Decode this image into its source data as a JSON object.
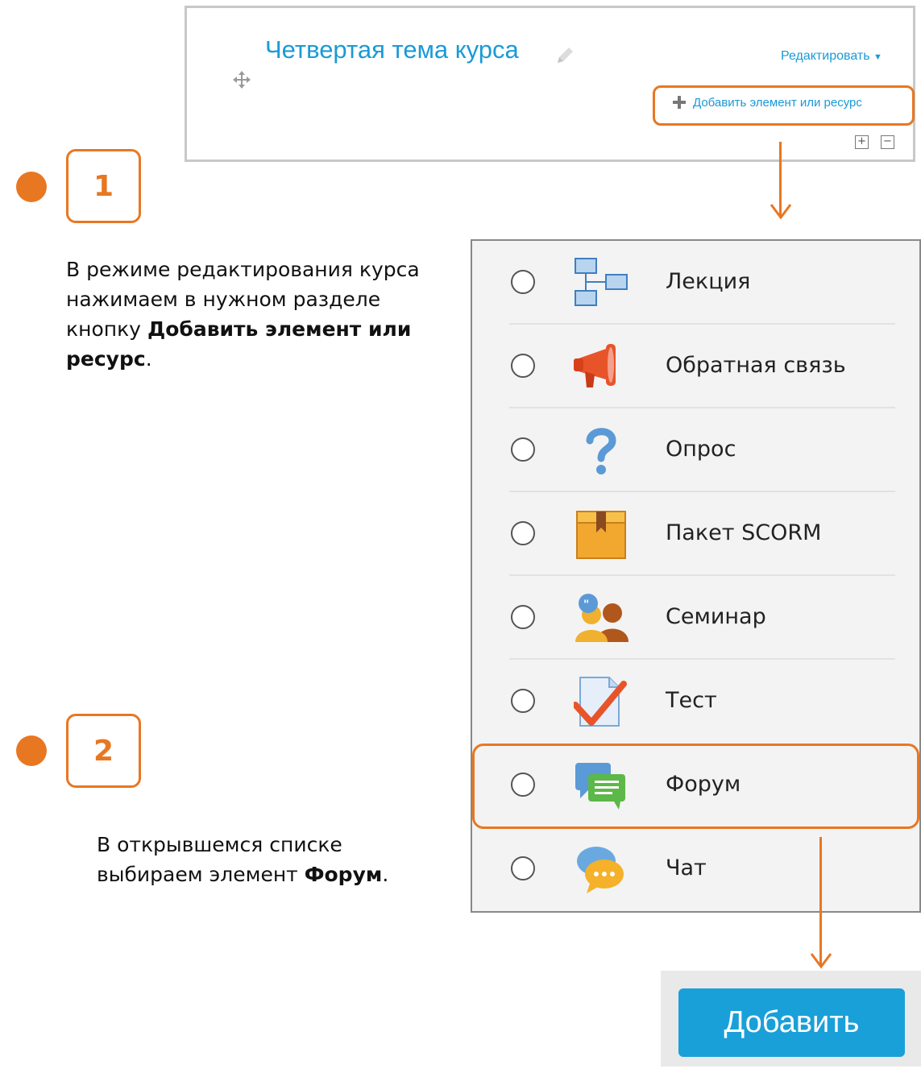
{
  "section": {
    "title": "Четвертая тема курса",
    "edit_label": "Редактировать",
    "add_link_label": "Добавить элемент или ресурс"
  },
  "steps": [
    {
      "number": "1",
      "text_plain": "В режиме редактирования курса нажимаем в нужном разделе кнопку ",
      "text_bold": "Добавить элемент или ресурс",
      "text_end": "."
    },
    {
      "number": "2",
      "text_plain": "В открывшемся списке выбираем элемент ",
      "text_bold": "Форум",
      "text_end": "."
    }
  ],
  "activities": [
    {
      "label": "Лекция",
      "icon": "lesson-icon"
    },
    {
      "label": "Обратная связь",
      "icon": "feedback-icon"
    },
    {
      "label": "Опрос",
      "icon": "choice-icon"
    },
    {
      "label": "Пакет SCORM",
      "icon": "scorm-icon"
    },
    {
      "label": "Семинар",
      "icon": "workshop-icon"
    },
    {
      "label": "Тест",
      "icon": "quiz-icon"
    },
    {
      "label": "Форум",
      "icon": "forum-icon"
    },
    {
      "label": "Чат",
      "icon": "chat-icon"
    }
  ],
  "selected_activity": "Форум",
  "add_button_label": "Добавить",
  "colors": {
    "accent": "#e87722",
    "link": "#1a9ad6",
    "button": "#1aa0d8"
  }
}
